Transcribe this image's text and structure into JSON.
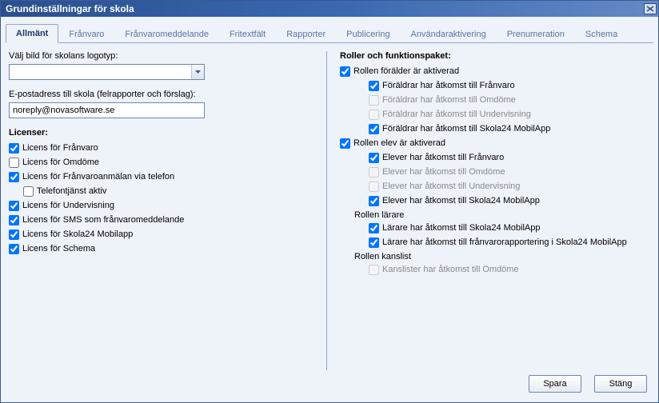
{
  "window": {
    "title": "Grundinställningar för skola"
  },
  "tabs": [
    {
      "label": "Allmänt",
      "active": true
    },
    {
      "label": "Frånvaro"
    },
    {
      "label": "Frånvaromeddelande"
    },
    {
      "label": "Fritextfält"
    },
    {
      "label": "Rapporter"
    },
    {
      "label": "Publicering"
    },
    {
      "label": "Användaraktivering"
    },
    {
      "label": "Prenumeration"
    },
    {
      "label": "Schema"
    }
  ],
  "left": {
    "logo_label": "Välj bild för skolans logotyp:",
    "logo_value": "",
    "email_label": "E-postadress till skola (felrapporter och förslag):",
    "email_value": "noreply@novasoftware.se",
    "licenses_title": "Licenser:",
    "licenses": [
      {
        "label": "Licens för Frånvaro",
        "checked": true,
        "indent": 0
      },
      {
        "label": "Licens för Omdöme",
        "checked": false,
        "indent": 0
      },
      {
        "label": "Licens för Frånvaroanmälan via telefon",
        "checked": true,
        "indent": 0
      },
      {
        "label": "Telefontjänst aktiv",
        "checked": false,
        "indent": 1
      },
      {
        "label": "Licens för Undervisning",
        "checked": true,
        "indent": 0
      },
      {
        "label": "Licens för SMS som frånvaromeddelande",
        "checked": true,
        "indent": 0
      },
      {
        "label": "Licens för Skola24 Mobilapp",
        "checked": true,
        "indent": 0
      },
      {
        "label": "Licens för Schema",
        "checked": true,
        "indent": 0
      }
    ]
  },
  "right": {
    "title": "Roller och funktionspaket:",
    "groups": [
      {
        "head": {
          "label": "Rollen förälder är aktiverad",
          "checked": true,
          "hasCheckbox": true,
          "headIndent": 0
        },
        "items": [
          {
            "label": "Föräldrar har åtkomst till Frånvaro",
            "checked": true,
            "disabled": false
          },
          {
            "label": "Föräldrar har åtkomst till Omdöme",
            "checked": false,
            "disabled": true
          },
          {
            "label": "Föräldrar har åtkomst till Undervisning",
            "checked": false,
            "disabled": true
          },
          {
            "label": "Föräldrar har åtkomst till Skola24 MobilApp",
            "checked": true,
            "disabled": false
          }
        ]
      },
      {
        "head": {
          "label": "Rollen elev är aktiverad",
          "checked": true,
          "hasCheckbox": true,
          "headIndent": 0
        },
        "items": [
          {
            "label": "Elever har åtkomst till Frånvaro",
            "checked": true,
            "disabled": false
          },
          {
            "label": "Elever har åtkomst till Omdöme",
            "checked": false,
            "disabled": true
          },
          {
            "label": "Elever har åtkomst till Undervisning",
            "checked": false,
            "disabled": true
          },
          {
            "label": "Elever har åtkomst till Skola24 MobilApp",
            "checked": true,
            "disabled": false
          }
        ]
      },
      {
        "head": {
          "label": "Rollen lärare",
          "hasCheckbox": false,
          "headIndent": 1
        },
        "items": [
          {
            "label": "Lärare har åtkomst till Skola24 MobilApp",
            "checked": true,
            "disabled": false
          },
          {
            "label": "Lärare har åtkomst till frånvarorapportering i Skola24 MobilApp",
            "checked": true,
            "disabled": false
          }
        ]
      },
      {
        "head": {
          "label": "Rollen kanslist",
          "hasCheckbox": false,
          "headIndent": 1
        },
        "items": [
          {
            "label": "Kanslister har åtkomst till Omdöme",
            "checked": false,
            "disabled": true
          }
        ]
      }
    ]
  },
  "footer": {
    "save": "Spara",
    "close": "Stäng"
  }
}
